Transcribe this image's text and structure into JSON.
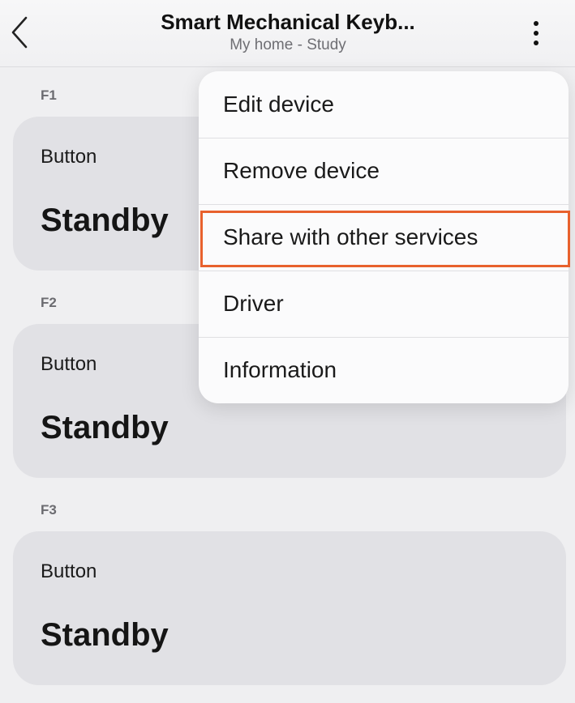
{
  "header": {
    "title": "Smart Mechanical Keyb...",
    "subtitle": "My home - Study",
    "back_icon": "chevron-left-icon",
    "more_icon": "more-vertical-icon"
  },
  "cards": [
    {
      "section": "F1",
      "label": "Button",
      "state": "Standby"
    },
    {
      "section": "F2",
      "label": "Button",
      "state": "Standby"
    },
    {
      "section": "F3",
      "label": "Button",
      "state": "Standby"
    }
  ],
  "menu": {
    "items": [
      {
        "label": "Edit device"
      },
      {
        "label": "Remove device"
      },
      {
        "label": "Share with other services"
      },
      {
        "label": "Driver"
      },
      {
        "label": "Information"
      }
    ]
  },
  "colors": {
    "highlight": "#e8612d",
    "card_background": "#e1e1e5",
    "menu_background": "#fbfbfc"
  }
}
